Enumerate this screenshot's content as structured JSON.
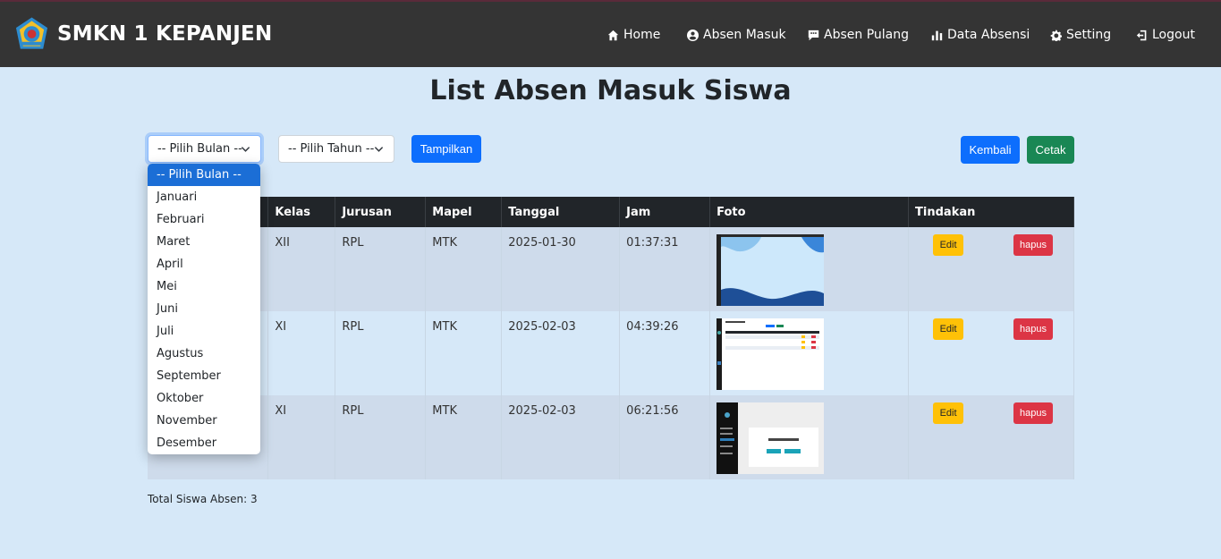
{
  "navbar": {
    "brand": "SMKN 1 KEPANJEN",
    "items": [
      {
        "label": "Home",
        "icon": "home-icon"
      },
      {
        "label": "Absen Masuk",
        "icon": "user-circle-icon"
      },
      {
        "label": "Absen Pulang",
        "icon": "message-icon"
      },
      {
        "label": "Data Absensi",
        "icon": "bar-chart-icon"
      },
      {
        "label": "Setting",
        "icon": "gear-icon"
      },
      {
        "label": "Logout",
        "icon": "logout-icon"
      }
    ]
  },
  "page": {
    "title": "List Absen Masuk Siswa"
  },
  "filters": {
    "bulan_selected": "-- Pilih Bulan --",
    "tahun_selected": "-- Pilih Tahun --",
    "tampilkan_label": "Tampilkan",
    "kembali_label": "Kembali",
    "cetak_label": "Cetak"
  },
  "bulan_options": [
    "-- Pilih Bulan --",
    "Januari",
    "Februari",
    "Maret",
    "April",
    "Mei",
    "Juni",
    "Juli",
    "Agustus",
    "September",
    "Oktober",
    "November",
    "Desember"
  ],
  "table": {
    "headers": [
      "Kelas",
      "Jurusan",
      "Mapel",
      "Tanggal",
      "Jam",
      "Foto",
      "Tindakan"
    ],
    "rows": [
      {
        "kelas": "XII",
        "jurusan": "RPL",
        "mapel": "MTK",
        "tanggal": "2025-01-30",
        "jam": "01:37:31"
      },
      {
        "kelas": "XI",
        "jurusan": "RPL",
        "mapel": "MTK",
        "tanggal": "2025-02-03",
        "jam": "04:39:26"
      },
      {
        "kelas": "XI",
        "jurusan": "RPL",
        "mapel": "MTK",
        "tanggal": "2025-02-03",
        "jam": "06:21:56"
      }
    ],
    "edit_label": "Edit",
    "hapus_label": "hapus"
  },
  "total": "Total Siswa Absen: 3",
  "colors": {
    "navbar": "#343434",
    "background": "#d6e8f8",
    "primary": "#0d6efd",
    "success": "#198754",
    "warning": "#ffc107",
    "danger": "#dc3545"
  }
}
